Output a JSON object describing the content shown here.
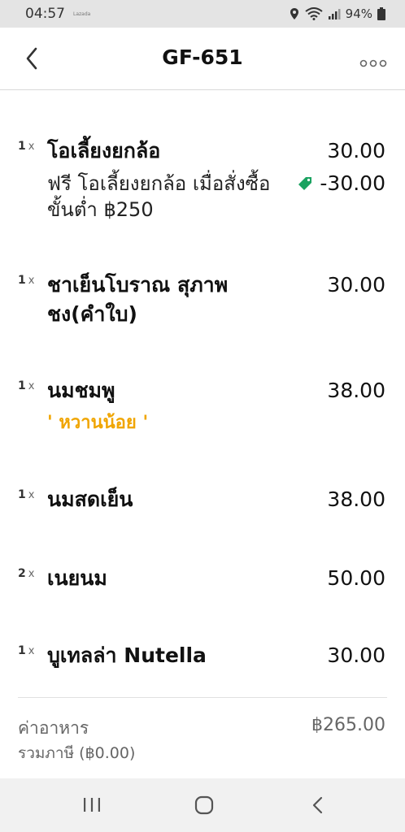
{
  "status_bar": {
    "time": "04:57",
    "brand": "Lazada",
    "battery": "94%",
    "icons": [
      "location-icon",
      "wifi-icon",
      "signal-icon",
      "battery-icon"
    ]
  },
  "header": {
    "title": "GF-651",
    "back_icon": "chevron-left-icon",
    "more_icon": "more-dots-icon"
  },
  "items": [
    {
      "qty": "1",
      "x": "x",
      "name": "โอเลี้ยงยกล้อ",
      "price": "30.00"
    },
    {
      "qty": "1",
      "x": "x",
      "name": "ชาเย็นโบราณ สุภาพ ชง(คำใบ)",
      "price": "30.00"
    },
    {
      "qty": "1",
      "x": "x",
      "name": "นมชมพู",
      "price": "38.00",
      "note": "' หวานน้อย '"
    },
    {
      "qty": "1",
      "x": "x",
      "name": "นมสดเย็น",
      "price": "38.00"
    },
    {
      "qty": "2",
      "x": "x",
      "name": "เนยนม",
      "price": "50.00"
    },
    {
      "qty": "1",
      "x": "x",
      "name": "บูเทลล่า Nutella",
      "price": "30.00"
    }
  ],
  "promo": {
    "text": "ฟรี โอเลี้ยงยกล้อ เมื่อสั่งซื้อขั้นต่ำ ฿250",
    "amount": "-30.00",
    "icon": "tag-icon",
    "color": "#1aa260"
  },
  "summary": {
    "label": "ค่าอาหาร",
    "sublabel": "รวมภาษี (฿0.00)",
    "value": "฿265.00"
  },
  "colors": {
    "note": "#f0a500",
    "tag": "#1aa260"
  },
  "nav_icons": [
    "recent-apps-icon",
    "home-icon",
    "back-icon"
  ]
}
